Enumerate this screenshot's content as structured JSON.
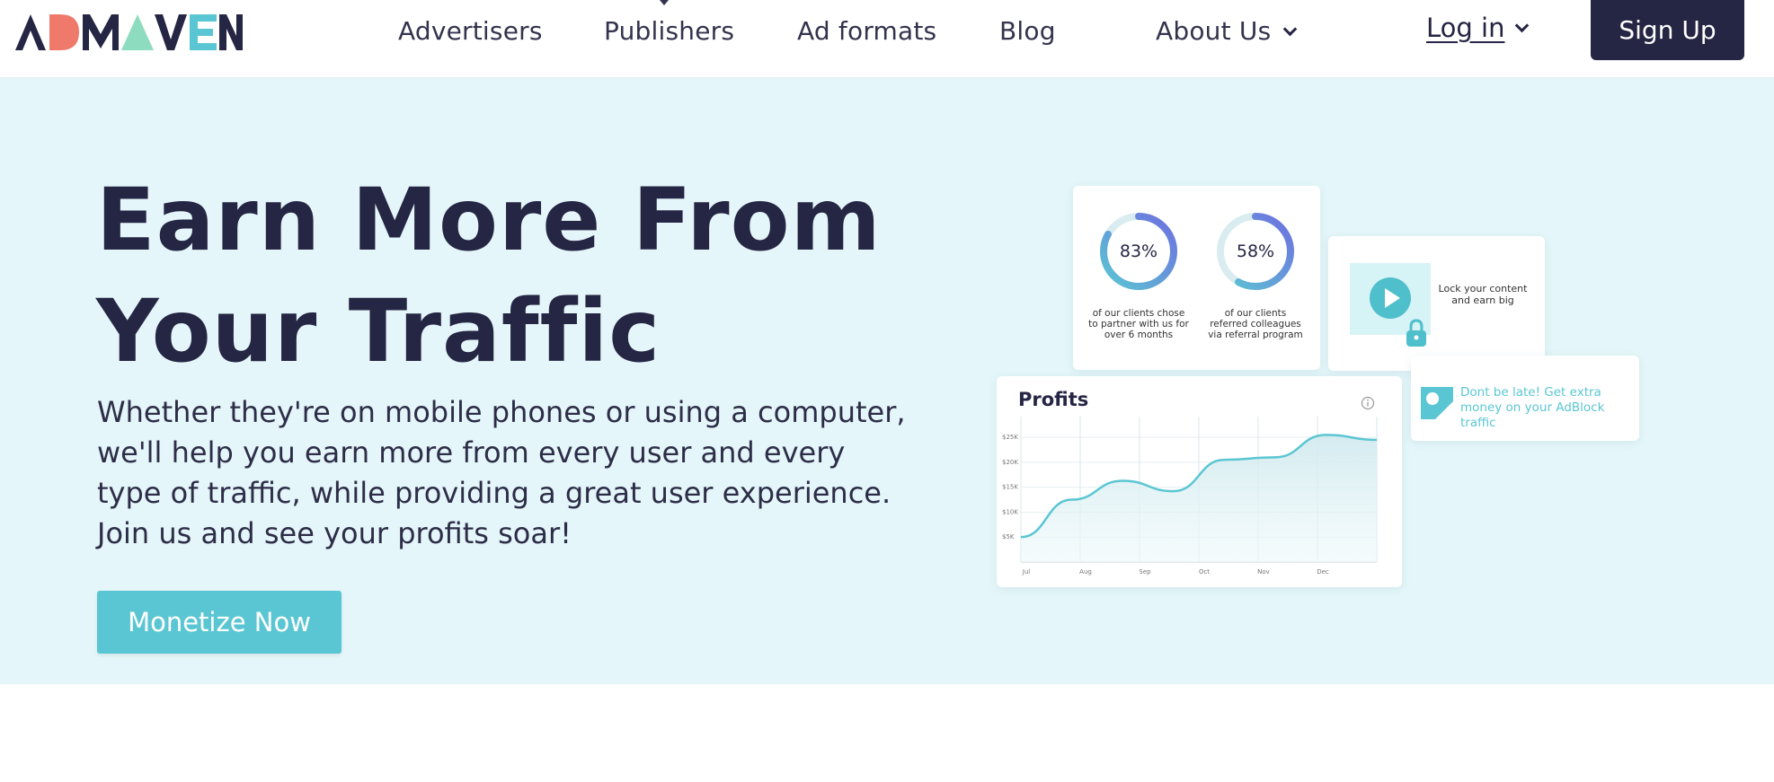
{
  "header": {
    "logo_text": "ADMAVEN",
    "nav": [
      {
        "label": "Advertisers"
      },
      {
        "label": "Publishers"
      },
      {
        "label": "Ad formats"
      },
      {
        "label": "Blog"
      },
      {
        "label": "About Us"
      }
    ],
    "login_label": "Log in",
    "signup_label": "Sign Up"
  },
  "hero": {
    "title_line1": "Earn More From",
    "title_line2": "Your Traffic",
    "description": "Whether they're on mobile phones or using a computer, we'll help you earn more from every user and every type of traffic, while providing a great user experience. Join us and see your profits soar!",
    "cta_label": "Monetize Now"
  },
  "stats": [
    {
      "value": "83%",
      "percent": 83,
      "caption": "of our clients chose to partner with us for over 6 months"
    },
    {
      "value": "58%",
      "percent": 58,
      "caption": "of our clients referred colleagues via referral program"
    }
  ],
  "video_card": {
    "text": "Lock your content and earn big"
  },
  "adblock_card": {
    "text": "Dont be late! Get extra money on your AdBlock traffic"
  },
  "chart_data": {
    "type": "area",
    "title": "Profits",
    "categories": [
      "Jul",
      "Aug",
      "Sep",
      "Oct",
      "Nov",
      "Dec"
    ],
    "y_ticks": [
      "$5K",
      "$10K",
      "$15K",
      "$20K",
      "$25K"
    ],
    "ylim": [
      0,
      27
    ],
    "series": [
      {
        "values": [
          5,
          12.5,
          16.3,
          14.2,
          20.5,
          21,
          25.5,
          24.5
        ]
      }
    ],
    "grid": true
  },
  "colors": {
    "brand_dark": "#252544",
    "accent_teal": "#5bc6d3",
    "hero_bg": "#e4f6f9",
    "logo_coral": "#ef7a6b",
    "logo_mint": "#8edcc0",
    "logo_teal": "#5bc6d3"
  },
  "icons": [
    "chevron-down-icon",
    "play-icon",
    "lock-icon",
    "image-icon",
    "info-icon"
  ]
}
